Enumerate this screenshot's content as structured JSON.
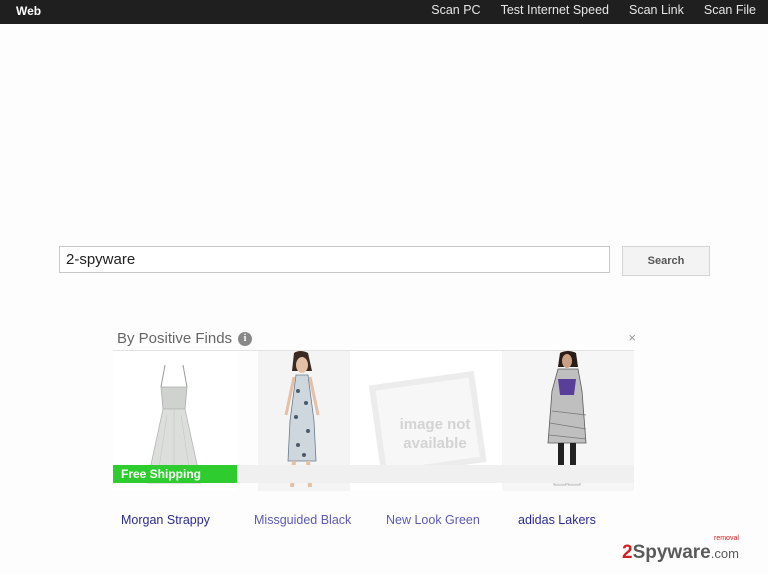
{
  "topbar": {
    "brand": "Web",
    "nav": [
      "Scan PC",
      "Test Internet Speed",
      "Scan Link",
      "Scan File"
    ]
  },
  "search": {
    "value": "2-spyware",
    "button_label": "Search"
  },
  "ad": {
    "header": "By Positive Finds",
    "info_icon": "info-icon",
    "close_icon": "×",
    "shipping_badge": "Free Shipping",
    "image_placeholder": "image not available",
    "products": [
      {
        "title": "Morgan Strappy",
        "color": "#2b2b8f"
      },
      {
        "title": "Missguided Black",
        "color": "#5a5ab5"
      },
      {
        "title": "New Look Green",
        "color": "#5a5ab5"
      },
      {
        "title": "adidas Lakers",
        "color": "#2b2b8f"
      }
    ]
  },
  "watermark": {
    "two": "2",
    "brand": "Spyware",
    "tld": ".com",
    "tag": "removal"
  },
  "colors": {
    "topbar": "#1f1f1f",
    "shipping_badge": "#2ecc2e",
    "link": "#2b2b8f"
  }
}
